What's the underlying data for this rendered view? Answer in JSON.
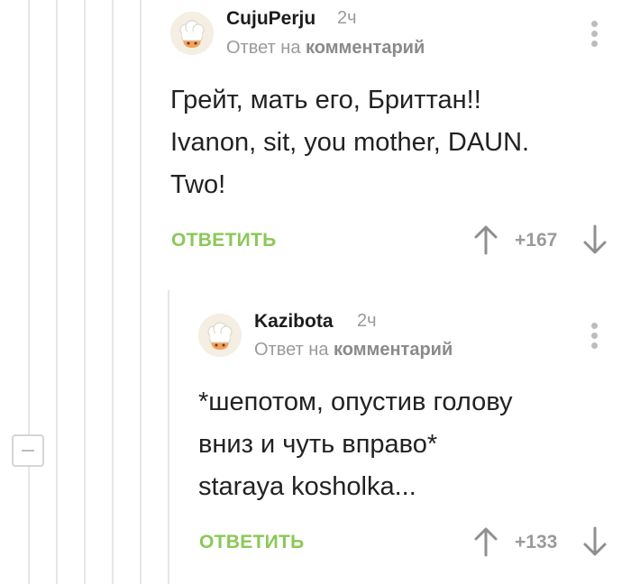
{
  "comments": [
    {
      "username": "CujuPerju",
      "time": "2ч",
      "reply_prefix": "Ответ на",
      "reply_link": "комментарий",
      "lines": [
        "Грейт, мать его, Бриттан!!",
        "Ivanon, sit, you mother, DAUN.",
        "Two!"
      ],
      "reply_label": "ОТВЕТИТЬ",
      "rating": "+167"
    },
    {
      "username": "Kazibota",
      "time": "2ч",
      "reply_prefix": "Ответ на",
      "reply_link": "комментарий",
      "lines": [
        "*шепотом, опустив голову",
        "вниз и чуть вправо*",
        "staraya kosholka..."
      ],
      "reply_label": "ОТВЕТИТЬ",
      "rating": "+133"
    }
  ],
  "icons": {
    "avatar": "chef-hat-avatar-icon",
    "menu": "more-vertical-icon",
    "upvote": "arrow-up-icon",
    "downvote": "arrow-down-icon",
    "collapse": "minus-icon"
  },
  "colors": {
    "reply_green": "#8ac858",
    "muted_gray": "#9a9a9a",
    "thread_line": "#e6e6e6"
  }
}
